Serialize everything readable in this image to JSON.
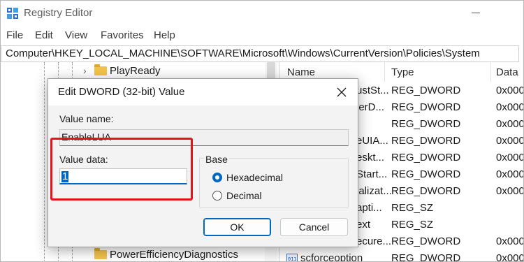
{
  "app": {
    "title": "Registry Editor",
    "icon": "registry-icon"
  },
  "menu": [
    "File",
    "Edit",
    "View",
    "Favorites",
    "Help"
  ],
  "address": "Computer\\HKEY_LOCAL_MACHINE\\SOFTWARE\\Microsoft\\Windows\\CurrentVersion\\Policies\\System",
  "tree": {
    "items": [
      {
        "label": "PlayReady",
        "expandable": true
      },
      {
        "label": "PowerEfficiencyDiagnostics",
        "expandable": false
      }
    ]
  },
  "list": {
    "columns": [
      "Name",
      "Type",
      "Data"
    ],
    "rows": [
      {
        "name": "ustSt...",
        "type": "REG_DWORD",
        "data": "0x000"
      },
      {
        "name": "lerD...",
        "type": "REG_DWORD",
        "data": "0x000"
      },
      {
        "name": "",
        "type": "REG_DWORD",
        "data": "0x000"
      },
      {
        "name": "eUIA...",
        "type": "REG_DWORD",
        "data": "0x000"
      },
      {
        "name": "eskt...",
        "type": "REG_DWORD",
        "data": "0x000"
      },
      {
        "name": "Start...",
        "type": "REG_DWORD",
        "data": "0x000"
      },
      {
        "name": "ializat...",
        "type": "REG_DWORD",
        "data": "0x000"
      },
      {
        "name": "apti...",
        "type": "REG_SZ",
        "data": ""
      },
      {
        "name": "ext",
        "type": "REG_SZ",
        "data": ""
      },
      {
        "name": "ecure...",
        "type": "REG_DWORD",
        "data": "0x000"
      },
      {
        "name": "scforceoption",
        "type": "REG_DWORD",
        "data": "0x000"
      }
    ]
  },
  "dialog": {
    "title": "Edit DWORD (32-bit) Value",
    "value_name_label": "Value name:",
    "value_name": "EnableLUA",
    "value_data_label": "Value data:",
    "value_data": "1",
    "base_label": "Base",
    "base_options": [
      {
        "label": "Hexadecimal",
        "selected": true
      },
      {
        "label": "Decimal",
        "selected": false
      }
    ],
    "ok_label": "OK",
    "cancel_label": "Cancel"
  },
  "colors": {
    "accent": "#0067c0",
    "highlight_box": "#e4141c",
    "folder": "#f3c349"
  }
}
